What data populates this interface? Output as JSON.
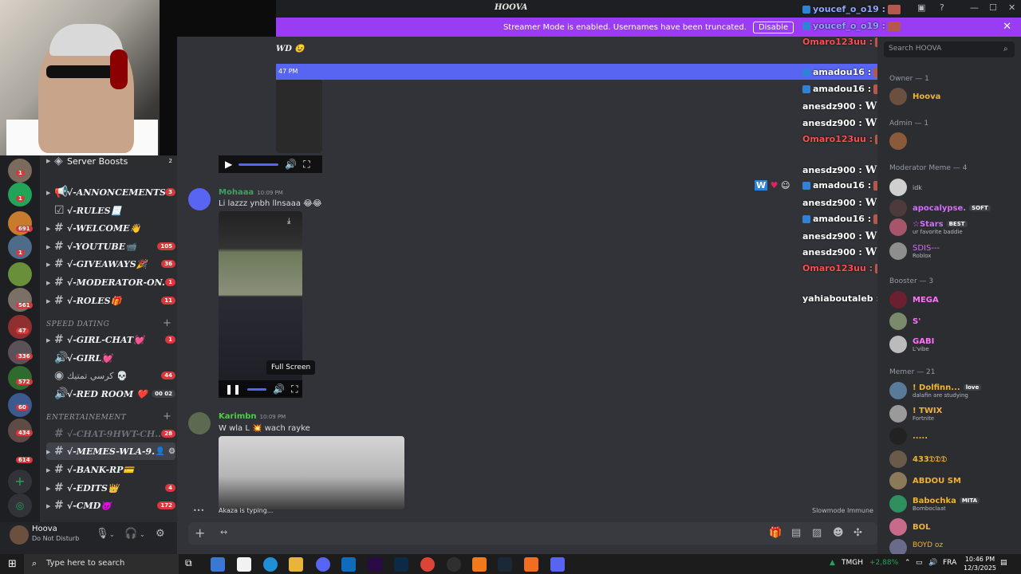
{
  "window": {
    "title": "HOOVA"
  },
  "banner": {
    "text": "Streamer Mode is enabled. Usernames have been truncated.",
    "disable_label": "Disable"
  },
  "channels": {
    "server_boosts": {
      "label": "Server Boosts",
      "count": "2"
    },
    "items": [
      {
        "label": "√-ANNONCEMENTS...",
        "count": "3"
      },
      {
        "label": "√-RULES📃",
        "count": ""
      },
      {
        "label": "√-WELCOME👋",
        "count": ""
      },
      {
        "label": "√-YOUTUBE📹",
        "count": "105"
      },
      {
        "label": "√-GIVEAWAYS🎉",
        "count": "36"
      },
      {
        "label": "√-MODERATOR-ON...",
        "count": "1"
      },
      {
        "label": "√-ROLES🎁",
        "count": "11"
      },
      {
        "label": "√-GIRL-CHAT💓",
        "count": "1"
      },
      {
        "label": "√-GIRL💓",
        "count": ""
      },
      {
        "label": "كرسي تمتيك 💀",
        "count": "44"
      },
      {
        "label": "√-RED ROOM ❤️",
        "count": "00  02"
      },
      {
        "label": "√-CHAT-9HWT-CH...",
        "count": "28"
      },
      {
        "label": "√-MEMES-WLA-9...",
        "count": ""
      },
      {
        "label": "√-BANK-RP💳",
        "count": ""
      },
      {
        "label": "√-EDITS👑",
        "count": "4"
      },
      {
        "label": "√-CMD😈",
        "count": "172"
      }
    ],
    "categories": {
      "speed_dating": "SPEED DATING",
      "entertainement": "ENTERTAINEMENT"
    }
  },
  "rail_badges": [
    "1",
    "1",
    "691",
    "1",
    "561",
    "47",
    "336",
    "572",
    "60",
    "434",
    "614"
  ],
  "user": {
    "name": "Hoova",
    "status": "Do Not Disturb"
  },
  "chat": {
    "partial_header": "WD 😉",
    "new_bar_time": "47 PM",
    "messages": [
      {
        "author": "Mohaaa",
        "time": "10:09 PM",
        "text": "Li lazzz ynbh llnsaaa 😂😂",
        "color": "#3ba55d"
      },
      {
        "author": "Karimbn",
        "time": "10:09 PM",
        "text": "W wla L  💥 wach rayke",
        "color": "#57c84d"
      }
    ],
    "tooltip": "Full Screen",
    "typing": "Akaza is typing...",
    "slowmode": "Slowmode Immune"
  },
  "stream_chat": [
    {
      "user": "youcef_o_o19 :",
      "color": "blue",
      "bot": true,
      "emotes": 1,
      "w": 0
    },
    {
      "user": "youcef_o_o19 :",
      "color": "blue",
      "bot": true,
      "emotes": 1,
      "w": 0
    },
    {
      "user": "Omaro123uu :",
      "color": "red",
      "bot": false,
      "emotes": 8,
      "w": 0
    },
    {
      "user": "amadou16 :",
      "color": "white",
      "bot": true,
      "emotes": 1,
      "w": 0
    },
    {
      "user": "amadou16 :",
      "color": "white",
      "bot": true,
      "emotes": 1,
      "w": 0
    },
    {
      "user": "anesdz900 :",
      "color": "white",
      "bot": false,
      "emotes": 0,
      "w": 1
    },
    {
      "user": "anesdz900 :",
      "color": "white",
      "bot": false,
      "emotes": 0,
      "w": 1
    },
    {
      "user": "Omaro123uu :",
      "color": "red",
      "bot": false,
      "emotes": 8,
      "w": 0
    },
    {
      "user": "anesdz900 :",
      "color": "white",
      "bot": false,
      "emotes": 0,
      "w": 1
    },
    {
      "user": "amadou16 :",
      "color": "white",
      "bot": true,
      "emotes": 1,
      "w": 0
    },
    {
      "user": "anesdz900 :",
      "color": "white",
      "bot": false,
      "emotes": 0,
      "w": 1
    },
    {
      "user": "amadou16 :",
      "color": "white",
      "bot": true,
      "emotes": 1,
      "w": 0
    },
    {
      "user": "anesdz900 :",
      "color": "white",
      "bot": false,
      "emotes": 0,
      "w": 1
    },
    {
      "user": "anesdz900 :",
      "color": "white",
      "bot": false,
      "emotes": 0,
      "w": 1
    },
    {
      "user": "Omaro123uu :",
      "color": "red",
      "bot": false,
      "emotes": 8,
      "w": 0
    },
    {
      "user": "yahiaboutaleb : zabbi",
      "color": "white",
      "bot": false,
      "emotes": 0,
      "w": 0
    }
  ],
  "members": {
    "search_placeholder": "Search HOOVA",
    "groups": [
      {
        "label": "Owner — 1"
      },
      {
        "label": "Admin — 1"
      },
      {
        "label": "Moderator Meme — 4"
      },
      {
        "label": "Booster — 3"
      },
      {
        "label": "Memer — 21"
      }
    ],
    "owner": [
      {
        "name": "Hoova",
        "sub": "",
        "tag": "",
        "color": "#f0b232"
      }
    ],
    "moderators": [
      {
        "name": "idk",
        "sub": "",
        "tag": "",
        "color": "#b5bac1"
      },
      {
        "name": "apocalypse.",
        "sub": "",
        "tag": "SOFT",
        "color": "#d46bff"
      },
      {
        "name": "☆Stars",
        "sub": "ur favorite baddie",
        "tag": "BEST",
        "color": "#d46bff"
      },
      {
        "name": "SDIS---",
        "sub": "Roblox",
        "tag": "",
        "color": "#d46bff"
      }
    ],
    "boosters": [
      {
        "name": "MEGA",
        "sub": "",
        "tag": "",
        "color": "#ff73fa"
      },
      {
        "name": "S'",
        "sub": "",
        "tag": "",
        "color": "#ff73fa"
      },
      {
        "name": "GABI",
        "sub": "L'vibe",
        "tag": "",
        "color": "#ff73fa"
      }
    ],
    "memers": [
      {
        "name": "! Dolfinn...",
        "sub": "dalafin are studying",
        "tag": "love",
        "color": "#f0b232"
      },
      {
        "name": "! TWIX",
        "sub": "Fortnite",
        "tag": "",
        "color": "#f0b232"
      },
      {
        "name": ".....",
        "sub": "",
        "tag": "",
        "color": "#f0b232"
      },
      {
        "name": "433𝔇𝔇𝔇",
        "sub": "",
        "tag": "",
        "color": "#f0b232"
      },
      {
        "name": "ABDOU SM",
        "sub": "",
        "tag": "",
        "color": "#f0b232"
      },
      {
        "name": "Babochka",
        "sub": "Bomboclaat",
        "tag": "MITA",
        "color": "#f0b232"
      },
      {
        "name": "BOL",
        "sub": "",
        "tag": "",
        "color": "#f0b232"
      },
      {
        "name": "BOYD oz",
        "sub": "",
        "tag": "",
        "color": "#f0b232"
      }
    ]
  },
  "taskbar": {
    "search_placeholder": "Type here to search",
    "ticker_name": "TMGH",
    "ticker_change": "+2,88%",
    "lang": "FRA",
    "time": "10:46 PM",
    "date": "12/3/2025"
  }
}
